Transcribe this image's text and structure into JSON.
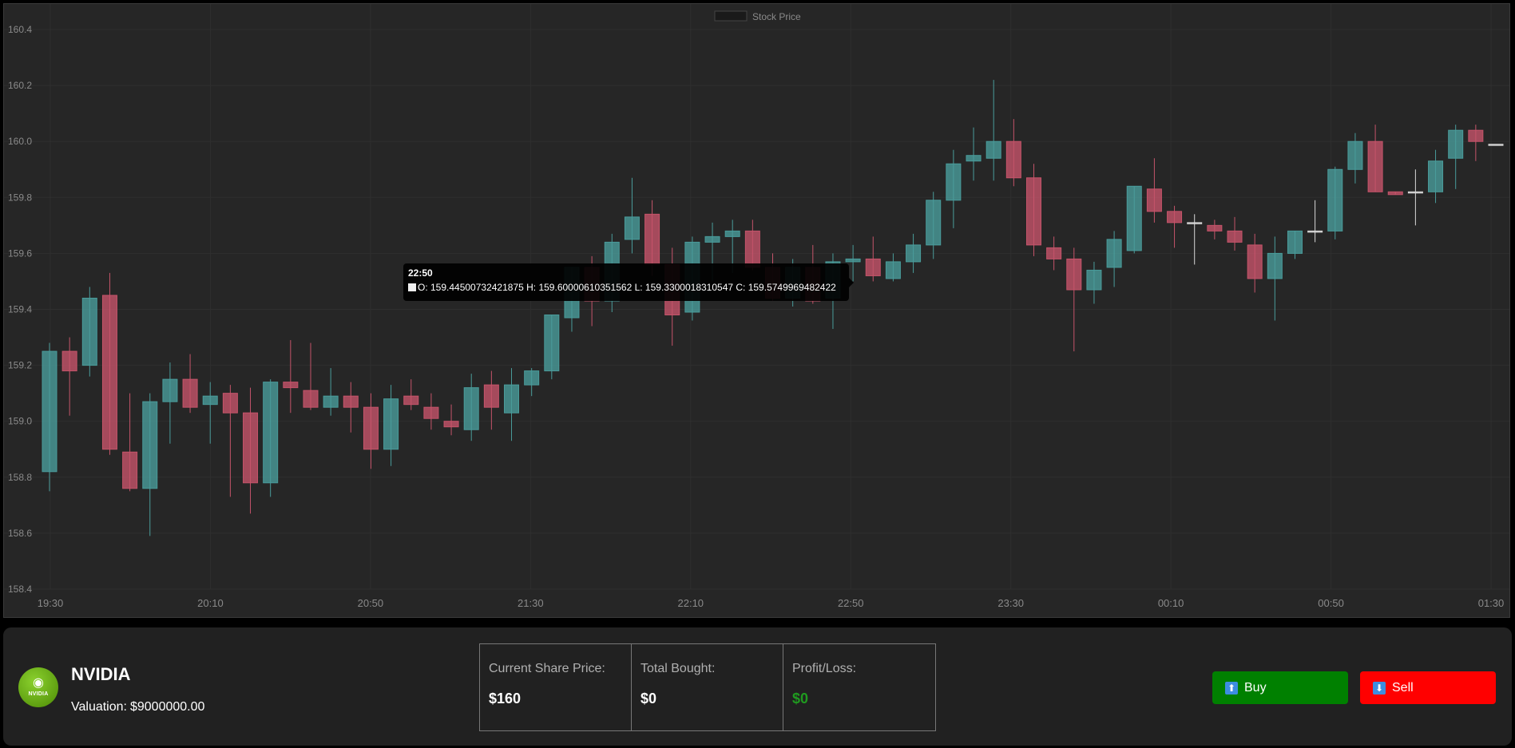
{
  "colors": {
    "up": "#4a9c9b",
    "down": "#c5546a",
    "neutral": "#d8d8d8",
    "grid": "#2f2f2f",
    "tick": "#8a8a8a"
  },
  "chart_data": {
    "type": "candlestick",
    "legend": {
      "label": "Stock Price",
      "position": "top-center"
    },
    "grid": true,
    "ylim": [
      158.4,
      160.4
    ],
    "yticks": [
      "158.4",
      "158.6",
      "158.8",
      "159.0",
      "159.2",
      "159.4",
      "159.6",
      "159.8",
      "160.0",
      "160.2",
      "160.4"
    ],
    "xticks": [
      "19:30",
      "20:10",
      "20:50",
      "21:30",
      "22:10",
      "22:50",
      "23:30",
      "00:10",
      "00:50",
      "01:30"
    ],
    "candles": [
      {
        "o": 158.82,
        "h": 159.28,
        "l": 158.75,
        "c": 159.25
      },
      {
        "o": 159.25,
        "h": 159.3,
        "l": 159.02,
        "c": 159.18
      },
      {
        "o": 159.2,
        "h": 159.48,
        "l": 159.16,
        "c": 159.44
      },
      {
        "o": 159.45,
        "h": 159.53,
        "l": 158.88,
        "c": 158.9
      },
      {
        "o": 158.89,
        "h": 159.1,
        "l": 158.75,
        "c": 158.76
      },
      {
        "o": 158.76,
        "h": 159.1,
        "l": 158.59,
        "c": 159.07
      },
      {
        "o": 159.07,
        "h": 159.21,
        "l": 158.92,
        "c": 159.15
      },
      {
        "o": 159.15,
        "h": 159.24,
        "l": 159.03,
        "c": 159.05
      },
      {
        "o": 159.06,
        "h": 159.14,
        "l": 158.92,
        "c": 159.09
      },
      {
        "o": 159.1,
        "h": 159.13,
        "l": 158.73,
        "c": 159.03
      },
      {
        "o": 159.03,
        "h": 159.12,
        "l": 158.67,
        "c": 158.78
      },
      {
        "o": 158.78,
        "h": 159.15,
        "l": 158.73,
        "c": 159.14
      },
      {
        "o": 159.14,
        "h": 159.29,
        "l": 159.03,
        "c": 159.12
      },
      {
        "o": 159.11,
        "h": 159.28,
        "l": 159.04,
        "c": 159.05
      },
      {
        "o": 159.05,
        "h": 159.19,
        "l": 159.02,
        "c": 159.09
      },
      {
        "o": 159.09,
        "h": 159.14,
        "l": 158.96,
        "c": 159.05
      },
      {
        "o": 159.05,
        "h": 159.1,
        "l": 158.83,
        "c": 158.9
      },
      {
        "o": 158.9,
        "h": 159.13,
        "l": 158.84,
        "c": 159.08
      },
      {
        "o": 159.09,
        "h": 159.15,
        "l": 159.04,
        "c": 159.06
      },
      {
        "o": 159.05,
        "h": 159.1,
        "l": 158.97,
        "c": 159.01
      },
      {
        "o": 159.0,
        "h": 159.06,
        "l": 158.95,
        "c": 158.98
      },
      {
        "o": 158.97,
        "h": 159.17,
        "l": 158.93,
        "c": 159.12
      },
      {
        "o": 159.13,
        "h": 159.18,
        "l": 158.97,
        "c": 159.05
      },
      {
        "o": 159.03,
        "h": 159.19,
        "l": 158.93,
        "c": 159.13
      },
      {
        "o": 159.13,
        "h": 159.19,
        "l": 159.09,
        "c": 159.18
      },
      {
        "o": 159.18,
        "h": 159.38,
        "l": 159.15,
        "c": 159.38
      },
      {
        "o": 159.37,
        "h": 159.55,
        "l": 159.32,
        "c": 159.55
      },
      {
        "o": 159.55,
        "h": 159.59,
        "l": 159.34,
        "c": 159.43
      },
      {
        "o": 159.43,
        "h": 159.67,
        "l": 159.39,
        "c": 159.64
      },
      {
        "o": 159.65,
        "h": 159.87,
        "l": 159.6,
        "c": 159.73
      },
      {
        "o": 159.74,
        "h": 159.79,
        "l": 159.52,
        "c": 159.56
      },
      {
        "o": 159.56,
        "h": 159.62,
        "l": 159.27,
        "c": 159.38
      },
      {
        "o": 159.39,
        "h": 159.66,
        "l": 159.36,
        "c": 159.64
      },
      {
        "o": 159.64,
        "h": 159.71,
        "l": 159.5,
        "c": 159.66
      },
      {
        "o": 159.66,
        "h": 159.72,
        "l": 159.53,
        "c": 159.68
      },
      {
        "o": 159.68,
        "h": 159.72,
        "l": 159.54,
        "c": 159.55
      },
      {
        "o": 159.55,
        "h": 159.6,
        "l": 159.43,
        "c": 159.44
      },
      {
        "o": 159.44,
        "h": 159.58,
        "l": 159.41,
        "c": 159.55
      },
      {
        "o": 159.55,
        "h": 159.63,
        "l": 159.42,
        "c": 159.43
      },
      {
        "o": 159.44,
        "h": 159.6,
        "l": 159.33,
        "c": 159.57
      },
      {
        "o": 159.57,
        "h": 159.63,
        "l": 159.5,
        "c": 159.58
      },
      {
        "o": 159.58,
        "h": 159.66,
        "l": 159.5,
        "c": 159.52
      },
      {
        "o": 159.51,
        "h": 159.6,
        "l": 159.5,
        "c": 159.57
      },
      {
        "o": 159.57,
        "h": 159.67,
        "l": 159.53,
        "c": 159.63
      },
      {
        "o": 159.63,
        "h": 159.82,
        "l": 159.58,
        "c": 159.79
      },
      {
        "o": 159.79,
        "h": 159.97,
        "l": 159.69,
        "c": 159.92
      },
      {
        "o": 159.93,
        "h": 160.05,
        "l": 159.86,
        "c": 159.95
      },
      {
        "o": 159.94,
        "h": 160.22,
        "l": 159.86,
        "c": 160.0
      },
      {
        "o": 160.0,
        "h": 160.08,
        "l": 159.84,
        "c": 159.87
      },
      {
        "o": 159.87,
        "h": 159.92,
        "l": 159.59,
        "c": 159.63
      },
      {
        "o": 159.62,
        "h": 159.66,
        "l": 159.54,
        "c": 159.58
      },
      {
        "o": 159.58,
        "h": 159.62,
        "l": 159.25,
        "c": 159.47
      },
      {
        "o": 159.47,
        "h": 159.57,
        "l": 159.42,
        "c": 159.54
      },
      {
        "o": 159.55,
        "h": 159.68,
        "l": 159.48,
        "c": 159.65
      },
      {
        "o": 159.61,
        "h": 159.84,
        "l": 159.6,
        "c": 159.84
      },
      {
        "o": 159.83,
        "h": 159.94,
        "l": 159.71,
        "c": 159.75
      },
      {
        "o": 159.75,
        "h": 159.77,
        "l": 159.62,
        "c": 159.71
      },
      {
        "o": 159.71,
        "h": 159.74,
        "l": 159.56,
        "c": 159.71
      },
      {
        "o": 159.7,
        "h": 159.72,
        "l": 159.65,
        "c": 159.68
      },
      {
        "o": 159.68,
        "h": 159.73,
        "l": 159.61,
        "c": 159.64
      },
      {
        "o": 159.63,
        "h": 159.67,
        "l": 159.46,
        "c": 159.51
      },
      {
        "o": 159.51,
        "h": 159.66,
        "l": 159.36,
        "c": 159.6
      },
      {
        "o": 159.6,
        "h": 159.68,
        "l": 159.58,
        "c": 159.68
      },
      {
        "o": 159.68,
        "h": 159.79,
        "l": 159.64,
        "c": 159.68
      },
      {
        "o": 159.68,
        "h": 159.91,
        "l": 159.65,
        "c": 159.9
      },
      {
        "o": 159.9,
        "h": 160.03,
        "l": 159.85,
        "c": 160.0
      },
      {
        "o": 160.0,
        "h": 160.06,
        "l": 159.82,
        "c": 159.82
      },
      {
        "o": 159.82,
        "h": 159.82,
        "l": 159.81,
        "c": 159.81
      },
      {
        "o": 159.82,
        "h": 159.9,
        "l": 159.7,
        "c": 159.82
      },
      {
        "o": 159.82,
        "h": 159.97,
        "l": 159.78,
        "c": 159.93
      },
      {
        "o": 159.94,
        "h": 160.06,
        "l": 159.83,
        "c": 160.04
      },
      {
        "o": 160.04,
        "h": 160.06,
        "l": 159.93,
        "c": 160.0
      },
      {
        "o": 159.99,
        "h": 159.99,
        "l": 159.99,
        "c": 159.99
      }
    ]
  },
  "tooltip": {
    "title": "22:50",
    "body": "O: 159.44500732421875  H: 159.60000610351562  L: 159.3300018310547  C: 159.5749969482422"
  },
  "company": {
    "logo_text": "NVIDIA",
    "name": "NVIDIA",
    "valuation_label": "Valuation:",
    "valuation_value": "$9000000.00"
  },
  "stats": {
    "price_label": "Current Share Price:",
    "price_value": "$160",
    "bought_label": "Total Bought:",
    "bought_value": "$0",
    "pl_label": "Profit/Loss:",
    "pl_value": "$0"
  },
  "buttons": {
    "buy_label": "Buy",
    "sell_label": "Sell"
  }
}
